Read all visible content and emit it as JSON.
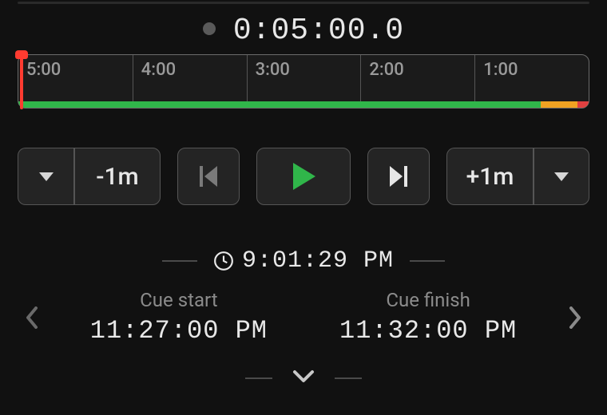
{
  "timer": {
    "elapsed": "0:05:00.0"
  },
  "timeline": {
    "ticks": [
      "5:00",
      "4:00",
      "3:00",
      "2:00",
      "1:00"
    ]
  },
  "controls": {
    "decrease_label": "-1m",
    "increase_label": "+1m"
  },
  "now": "9:01:29 PM",
  "cues": {
    "start_label": "Cue start",
    "start_value": "11:27:00 PM",
    "finish_label": "Cue finish",
    "finish_value": "11:32:00 PM"
  },
  "colors": {
    "play": "#30b64a",
    "amber": "#f0a222",
    "red": "#e04040"
  }
}
